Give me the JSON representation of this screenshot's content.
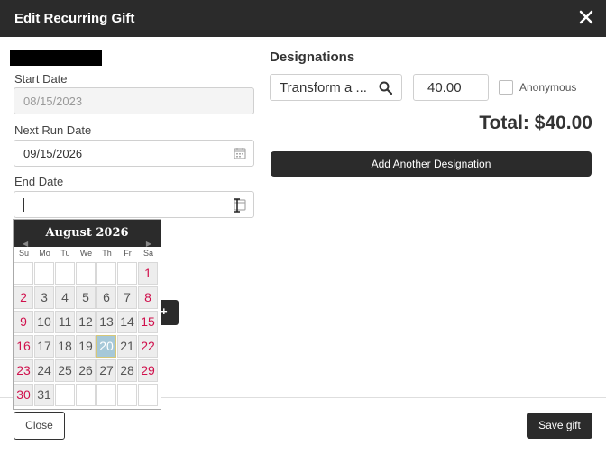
{
  "header": {
    "title": "Edit Recurring Gift"
  },
  "form": {
    "start_date_label": "Start Date",
    "start_date_value": "08/15/2023",
    "next_run_label": "Next Run Date",
    "next_run_value": "09/15/2026",
    "end_date_label": "End Date",
    "end_date_value": ""
  },
  "designations": {
    "heading": "Designations",
    "selected": "Transform a ...",
    "amount": "40.00",
    "anonymous_label": "Anonymous",
    "total": "Total: $40.00",
    "add_label": "Add Another Designation"
  },
  "calendar": {
    "month_label": "August 2026",
    "prev": "◀",
    "next": "▶",
    "weekdays": [
      "Su",
      "Mo",
      "Tu",
      "We",
      "Th",
      "Fr",
      "Sa"
    ],
    "leading_blanks": 6,
    "days_in_month": 31,
    "selected_day": 20
  },
  "footer": {
    "close_label": "Close",
    "save_label": "Save gift"
  },
  "colors": {
    "dark": "#2b2b2b",
    "weekend": "#d0104c",
    "today": "#a6c8d8"
  }
}
